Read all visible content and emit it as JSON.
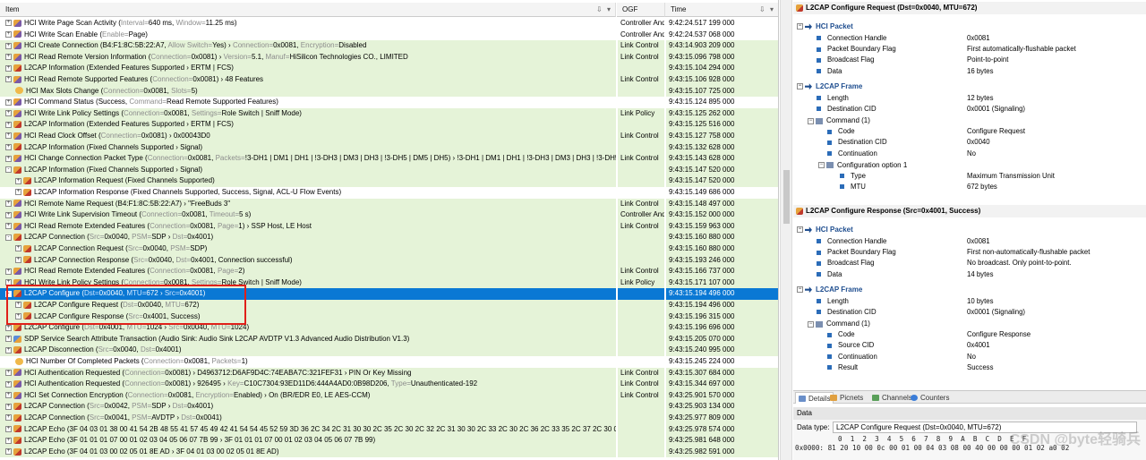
{
  "columns": {
    "item": "Item",
    "ogf": "OGF",
    "time": "Time"
  },
  "rows": [
    {
      "exp": "+",
      "icon": "hci",
      "segs": [
        [
          "HCI Write Page Scan Activity (",
          0
        ],
        [
          "Interval=",
          1
        ],
        [
          "640 ms, ",
          0
        ],
        [
          "Window=",
          1
        ],
        [
          "11.25 ms)",
          0
        ]
      ],
      "ogf": "Controller And",
      "time": "9:42:24.517 199 000",
      "green": false
    },
    {
      "exp": "+",
      "icon": "hci",
      "segs": [
        [
          "HCI Write Scan Enable (",
          0
        ],
        [
          "Enable=",
          1
        ],
        [
          "Page)",
          0
        ]
      ],
      "ogf": "Controller And",
      "time": "9:42:24.537 068 000",
      "green": false
    },
    {
      "exp": "+",
      "icon": "hci",
      "segs": [
        [
          "HCI Create Connection (B4:F1:8C:5B:22:A7, ",
          0
        ],
        [
          "Allow Switch=",
          1
        ],
        [
          "Yes) › ",
          0
        ],
        [
          "Connection=",
          1
        ],
        [
          "0x0081, ",
          0
        ],
        [
          "Encryption=",
          1
        ],
        [
          "Disabled",
          0
        ]
      ],
      "ogf": "Link Control",
      "time": "9:43:14.903 209 000",
      "green": true
    },
    {
      "exp": "+",
      "icon": "hci",
      "segs": [
        [
          "HCI Read Remote Version Information (",
          0
        ],
        [
          "Connection=",
          1
        ],
        [
          "0x0081) › ",
          0
        ],
        [
          "Version=",
          1
        ],
        [
          "5.1, ",
          0
        ],
        [
          "Manuf=",
          1
        ],
        [
          "HiSilicon Technologies CO., LIMITED",
          0
        ]
      ],
      "ogf": "Link Control",
      "time": "9:43:15.096 798 000",
      "green": true
    },
    {
      "exp": "+",
      "icon": "l2",
      "segs": [
        [
          "L2CAP Information (Extended Features Supported › ERTM | FCS)",
          0
        ]
      ],
      "ogf": "",
      "time": "9:43:15.104 294 000",
      "green": true
    },
    {
      "exp": "+",
      "icon": "hci",
      "segs": [
        [
          "HCI Read Remote Supported Features (",
          0
        ],
        [
          "Connection=",
          1
        ],
        [
          "0x0081) › 48 Features",
          0
        ]
      ],
      "ogf": "Link Control",
      "time": "9:43:15.106 928 000",
      "green": true
    },
    {
      "exp": "",
      "icon": "evt",
      "segs": [
        [
          "HCI Max Slots Change (",
          0
        ],
        [
          "Connection=",
          1
        ],
        [
          "0x0081, ",
          0
        ],
        [
          "Slots=",
          1
        ],
        [
          "5)",
          0
        ]
      ],
      "ogf": "",
      "time": "9:43:15.107 725 000",
      "green": true
    },
    {
      "exp": "+",
      "icon": "hci",
      "segs": [
        [
          "HCI Command Status (Success, ",
          0
        ],
        [
          "Command=",
          1
        ],
        [
          "Read Remote Supported Features)",
          0
        ]
      ],
      "ogf": "",
      "time": "9:43:15.124 895 000",
      "green": false
    },
    {
      "exp": "+",
      "icon": "hci",
      "segs": [
        [
          "HCI Write Link Policy Settings (",
          0
        ],
        [
          "Connection=",
          1
        ],
        [
          "0x0081, ",
          0
        ],
        [
          "Settings=",
          1
        ],
        [
          "Role Switch | Sniff Mode)",
          0
        ]
      ],
      "ogf": "Link Policy",
      "time": "9:43:15.125 262 000",
      "green": true
    },
    {
      "exp": "+",
      "icon": "l2",
      "segs": [
        [
          "L2CAP Information (Extended Features Supported › ERTM | FCS)",
          0
        ]
      ],
      "ogf": "",
      "time": "9:43:15.125 516 000",
      "green": true
    },
    {
      "exp": "+",
      "icon": "hci",
      "segs": [
        [
          "HCI Read Clock Offset (",
          0
        ],
        [
          "Connection=",
          1
        ],
        [
          "0x0081) › 0x00043D0",
          0
        ]
      ],
      "ogf": "Link Control",
      "time": "9:43:15.127 758 000",
      "green": true
    },
    {
      "exp": "+",
      "icon": "l2",
      "segs": [
        [
          "L2CAP Information (Fixed Channels Supported › Signal)",
          0
        ]
      ],
      "ogf": "",
      "time": "9:43:15.132 628 000",
      "green": true
    },
    {
      "exp": "+",
      "icon": "hci",
      "segs": [
        [
          "HCI Change Connection Packet Type (",
          0
        ],
        [
          "Connection=",
          1
        ],
        [
          "0x0081, ",
          0
        ],
        [
          "Packets=",
          1
        ],
        [
          "!3-DH1 | DM1 | DH1 | !3-DH3 | DM3 | DH3 | !3-DH5 | DM5 | DH5) › !3-DH1 | DM1 | DH1 | !3-DH3 | DM3 | DH3 | !3-DH5 | DM5 | ...",
          0
        ]
      ],
      "ogf": "Link Control",
      "time": "9:43:15.143 628 000",
      "green": true
    },
    {
      "exp": "-",
      "icon": "l2",
      "segs": [
        [
          "L2CAP Information (Fixed Channels Supported › Signal)",
          0
        ]
      ],
      "ogf": "",
      "time": "9:43:15.147 520 000",
      "green": true
    },
    {
      "exp": "+",
      "icon": "l2",
      "indent": 1,
      "segs": [
        [
          "L2CAP Information Request (Fixed Channels Supported)",
          0
        ]
      ],
      "ogf": "",
      "time": "9:43:15.147 520 000",
      "green": true
    },
    {
      "exp": "+",
      "icon": "l2",
      "indent": 1,
      "segs": [
        [
          "L2CAP Information Response (Fixed Channels Supported, Success, Signal, ACL-U Flow Events)",
          0
        ]
      ],
      "ogf": "",
      "time": "9:43:15.149 686 000",
      "green": false
    },
    {
      "exp": "+",
      "icon": "hci",
      "segs": [
        [
          "HCI Remote Name Request (B4:F1:8C:5B:22:A7) › \"FreeBuds 3\"",
          0
        ]
      ],
      "ogf": "Link Control",
      "time": "9:43:15.148 497 000",
      "green": true
    },
    {
      "exp": "+",
      "icon": "hci",
      "segs": [
        [
          "HCI Write Link Supervision Timeout (",
          0
        ],
        [
          "Connection=",
          1
        ],
        [
          "0x0081, ",
          0
        ],
        [
          "Timeout=",
          1
        ],
        [
          "5 s)",
          0
        ]
      ],
      "ogf": "Controller And",
      "time": "9:43:15.152 000 000",
      "green": true
    },
    {
      "exp": "+",
      "icon": "hci",
      "segs": [
        [
          "HCI Read Remote Extended Features (",
          0
        ],
        [
          "Connection=",
          1
        ],
        [
          "0x0081, ",
          0
        ],
        [
          "Page=",
          1
        ],
        [
          "1) › SSP Host, LE Host",
          0
        ]
      ],
      "ogf": "Link Control",
      "time": "9:43:15.159 963 000",
      "green": true
    },
    {
      "exp": "-",
      "icon": "l2",
      "segs": [
        [
          "L2CAP Connection (",
          0
        ],
        [
          "Src=",
          1
        ],
        [
          "0x0040, ",
          0
        ],
        [
          "PSM=",
          1
        ],
        [
          "SDP › ",
          0
        ],
        [
          "Dst=",
          1
        ],
        [
          "0x4001)",
          0
        ]
      ],
      "ogf": "",
      "time": "9:43:15.160 880 000",
      "green": true
    },
    {
      "exp": "+",
      "icon": "l2",
      "indent": 1,
      "segs": [
        [
          "L2CAP Connection Request (",
          0
        ],
        [
          "Src=",
          1
        ],
        [
          "0x0040, ",
          0
        ],
        [
          "PSM=",
          1
        ],
        [
          "SDP)",
          0
        ]
      ],
      "ogf": "",
      "time": "9:43:15.160 880 000",
      "green": true
    },
    {
      "exp": "+",
      "icon": "l2",
      "indent": 1,
      "segs": [
        [
          "L2CAP Connection Response (",
          0
        ],
        [
          "Src=",
          1
        ],
        [
          "0x0040, ",
          0
        ],
        [
          "Dst=",
          1
        ],
        [
          "0x4001, Connection successful)",
          0
        ]
      ],
      "ogf": "",
      "time": "9:43:15.193 246 000",
      "green": true
    },
    {
      "exp": "+",
      "icon": "hci",
      "segs": [
        [
          "HCI Read Remote Extended Features (",
          0
        ],
        [
          "Connection=",
          1
        ],
        [
          "0x0081, ",
          0
        ],
        [
          "Page=",
          1
        ],
        [
          "2)",
          0
        ]
      ],
      "ogf": "Link Control",
      "time": "9:43:15.166 737 000",
      "green": true
    },
    {
      "exp": "+",
      "icon": "hci",
      "segs": [
        [
          "HCI Write Link Policy Settings (",
          0
        ],
        [
          "Connection=",
          1
        ],
        [
          "0x0081, ",
          0
        ],
        [
          "Settings=",
          1
        ],
        [
          "Role Switch | Sniff Mode)",
          0
        ]
      ],
      "ogf": "Link Policy",
      "time": "9:43:15.171 107 000",
      "green": true
    },
    {
      "exp": "-",
      "icon": "l2",
      "sel": true,
      "segs": [
        [
          "L2CAP Configure (",
          0
        ],
        [
          "Dst=",
          1
        ],
        [
          "0x0040, ",
          0
        ],
        [
          "MTU=",
          1
        ],
        [
          "672 › ",
          0
        ],
        [
          "Src=",
          1
        ],
        [
          "0x4001)",
          0
        ]
      ],
      "ogf": "",
      "time": "9:43:15.194 496 000",
      "green": false
    },
    {
      "exp": "+",
      "icon": "l2",
      "indent": 1,
      "segs": [
        [
          "L2CAP Configure Request (",
          0
        ],
        [
          "Dst=",
          1
        ],
        [
          "0x0040, ",
          0
        ],
        [
          "MTU=",
          1
        ],
        [
          "672)",
          0
        ]
      ],
      "ogf": "",
      "time": "9:43:15.194 496 000",
      "green": true
    },
    {
      "exp": "+",
      "icon": "l2",
      "indent": 1,
      "segs": [
        [
          "L2CAP Configure Response (",
          0
        ],
        [
          "Src=",
          1
        ],
        [
          "0x4001, Success)",
          0
        ]
      ],
      "ogf": "",
      "time": "9:43:15.196 315 000",
      "green": true
    },
    {
      "exp": "+",
      "icon": "l2",
      "segs": [
        [
          "L2CAP Configure (",
          0
        ],
        [
          "Dst=",
          1
        ],
        [
          "0x4001, ",
          0
        ],
        [
          "MTU=",
          1
        ],
        [
          "1024 › ",
          0
        ],
        [
          "Src=",
          1
        ],
        [
          "0x0040, ",
          0
        ],
        [
          "MTU=",
          1
        ],
        [
          "1024)",
          0
        ]
      ],
      "ogf": "",
      "time": "9:43:15.196 696 000",
      "green": true
    },
    {
      "exp": "+",
      "icon": "sdp",
      "segs": [
        [
          "SDP Service Search Attribute Transaction (Audio Sink: Audio Sink L2CAP AVDTP V1.3 Advanced Audio Distribution V1.3)",
          0
        ]
      ],
      "ogf": "",
      "time": "9:43:15.205 070 000",
      "green": true
    },
    {
      "exp": "+",
      "icon": "l2",
      "segs": [
        [
          "L2CAP Disconnection (",
          0
        ],
        [
          "Src=",
          1
        ],
        [
          "0x0040, ",
          0
        ],
        [
          "Dst=",
          1
        ],
        [
          "0x4001)",
          0
        ]
      ],
      "ogf": "",
      "time": "9:43:15.240 995 000",
      "green": true
    },
    {
      "exp": "",
      "icon": "evt",
      "segs": [
        [
          "HCI Number Of Completed Packets (",
          0
        ],
        [
          "Connection=",
          1
        ],
        [
          "0x0081, ",
          0
        ],
        [
          "Packets=",
          1
        ],
        [
          "1)",
          0
        ]
      ],
      "ogf": "",
      "time": "9:43:15.245 224 000",
      "green": false
    },
    {
      "exp": "+",
      "icon": "hci",
      "segs": [
        [
          "HCI Authentication Requested (",
          0
        ],
        [
          "Connection=",
          1
        ],
        [
          "0x0081) › D4963712:D6AF9D4C:74EABA7C:321FEF31 › PIN Or Key Missing",
          0
        ]
      ],
      "ogf": "Link Control",
      "time": "9:43:15.307 684 000",
      "green": true
    },
    {
      "exp": "+",
      "icon": "hci",
      "segs": [
        [
          "HCI Authentication Requested (",
          0
        ],
        [
          "Connection=",
          1
        ],
        [
          "0x0081) › 926495 › ",
          0
        ],
        [
          "Key=",
          1
        ],
        [
          "C10C7304:93ED11D6:444A4AD0:0B98D206, ",
          0
        ],
        [
          "Type=",
          1
        ],
        [
          "Unauthenticated-192",
          0
        ]
      ],
      "ogf": "Link Control",
      "time": "9:43:15.344 697 000",
      "green": true
    },
    {
      "exp": "+",
      "icon": "hci",
      "segs": [
        [
          "HCI Set Connection Encryption (",
          0
        ],
        [
          "Connection=",
          1
        ],
        [
          "0x0081, ",
          0
        ],
        [
          "Encryption=",
          1
        ],
        [
          "Enabled) › On (BR/EDR E0, LE AES-CCM)",
          0
        ]
      ],
      "ogf": "Link Control",
      "time": "9:43:25.901 570 000",
      "green": true
    },
    {
      "exp": "+",
      "icon": "l2",
      "segs": [
        [
          "L2CAP Connection (",
          0
        ],
        [
          "Src=",
          1
        ],
        [
          "0x0042, ",
          0
        ],
        [
          "PSM=",
          1
        ],
        [
          "SDP › ",
          0
        ],
        [
          "Dst=",
          1
        ],
        [
          "0x4001)",
          0
        ]
      ],
      "ogf": "",
      "time": "9:43:25.903 134 000",
      "green": true
    },
    {
      "exp": "+",
      "icon": "l2",
      "segs": [
        [
          "L2CAP Connection (",
          0
        ],
        [
          "Src=",
          1
        ],
        [
          "0x0041, ",
          0
        ],
        [
          "PSM=",
          1
        ],
        [
          "AVDTP › ",
          0
        ],
        [
          "Dst=",
          1
        ],
        [
          "0x0041)",
          0
        ]
      ],
      "ogf": "",
      "time": "9:43:25.977 809 000",
      "green": true
    },
    {
      "exp": "+",
      "icon": "l2",
      "segs": [
        [
          "L2CAP Echo (3F 04 03 01 38 00 41 54 2B 48 55 41 57 45 49 42 41 54 54 45 52 59 3D 36 2C 34 2C 31 30 30 2C 35 2C 30 2C 32 2C 31 30 30 2C 33 2C 30 2C 36 2C 33 35 2C 37 2C 30 0D 00 00 ...",
          0
        ]
      ],
      "ogf": "",
      "time": "9:43:25.978 574 000",
      "green": true
    },
    {
      "exp": "+",
      "icon": "l2",
      "segs": [
        [
          "L2CAP Echo (3F 01 01 01 07 00 01 02 03 04 05 06 07 7B 99 › 3F 01 01 01 07 00 01 02 03 04 05 06 07 7B 99)",
          0
        ]
      ],
      "ogf": "",
      "time": "9:43:25.981 648 000",
      "green": true
    },
    {
      "exp": "+",
      "icon": "l2",
      "segs": [
        [
          "L2CAP Echo (3F 04 01 03 00 02 05 01 8E AD › 3F 04 01 03 00 02 05 01 8E AD)",
          0
        ]
      ],
      "ogf": "",
      "time": "9:43:25.982 591 000",
      "green": true
    }
  ],
  "details": {
    "request": {
      "title": "L2CAP Configure Request (Dst=0x0040, MTU=672)",
      "hci_packet": "HCI Packet",
      "hci_props": [
        [
          "Connection Handle",
          "0x0081"
        ],
        [
          "Packet Boundary Flag",
          "First automatically-flushable packet"
        ],
        [
          "Broadcast Flag",
          "Point-to-point"
        ],
        [
          "Data",
          "16 bytes"
        ]
      ],
      "l2cap_frame": "L2CAP Frame",
      "l2cap_props": [
        [
          "Length",
          "12 bytes"
        ],
        [
          "Destination CID",
          "0x0001 (Signaling)"
        ]
      ],
      "command": "Command (1)",
      "command_props": [
        [
          "Code",
          "Configure Request"
        ],
        [
          "Destination CID",
          "0x0040"
        ],
        [
          "Continuation",
          "No"
        ]
      ],
      "config_option": "Configuration option 1",
      "option_props": [
        [
          "Type",
          "Maximum Transmission Unit"
        ],
        [
          "MTU",
          "672 bytes"
        ]
      ]
    },
    "response": {
      "title": "L2CAP Configure Response (Src=0x4001, Success)",
      "hci_packet": "HCI Packet",
      "hci_props": [
        [
          "Connection Handle",
          "0x0081"
        ],
        [
          "Packet Boundary Flag",
          "First non-automatically-flushable packet"
        ],
        [
          "Broadcast Flag",
          "No broadcast. Only point-to-point."
        ],
        [
          "Data",
          "14 bytes"
        ]
      ],
      "l2cap_frame": "L2CAP Frame",
      "l2cap_props": [
        [
          "Length",
          "10 bytes"
        ],
        [
          "Destination CID",
          "0x0001 (Signaling)"
        ]
      ],
      "command": "Command (1)",
      "command_props": [
        [
          "Code",
          "Configure Response"
        ],
        [
          "Source CID",
          "0x4001"
        ],
        [
          "Continuation",
          "No"
        ],
        [
          "Result",
          "Success"
        ]
      ]
    }
  },
  "tabs": [
    {
      "label": "Details",
      "active": true
    },
    {
      "label": "Picnets",
      "active": false
    },
    {
      "label": "Channels",
      "active": false
    },
    {
      "label": "Counters",
      "active": false
    }
  ],
  "data_panel": {
    "header": "Data",
    "type_label": "Data type:",
    "type_value": "L2CAP Configure Request (Dst=0x0040, MTU=672)",
    "hex_header": "0  1  2  3  4  5  6  7  8  9  A  B  C  D  E  F",
    "hex_row": "0x0000: 81 20 10 00 0c 00 01 00 04 03 08 00 40 00 00 00 01 02 a0 02",
    "watermark": "CSDN @byte轻骑兵"
  },
  "colors": {
    "selection": "#0a78d4",
    "green_row": "#e5f3d8",
    "highlight_box": "#e0201a",
    "group_text": "#1f4e8f"
  }
}
